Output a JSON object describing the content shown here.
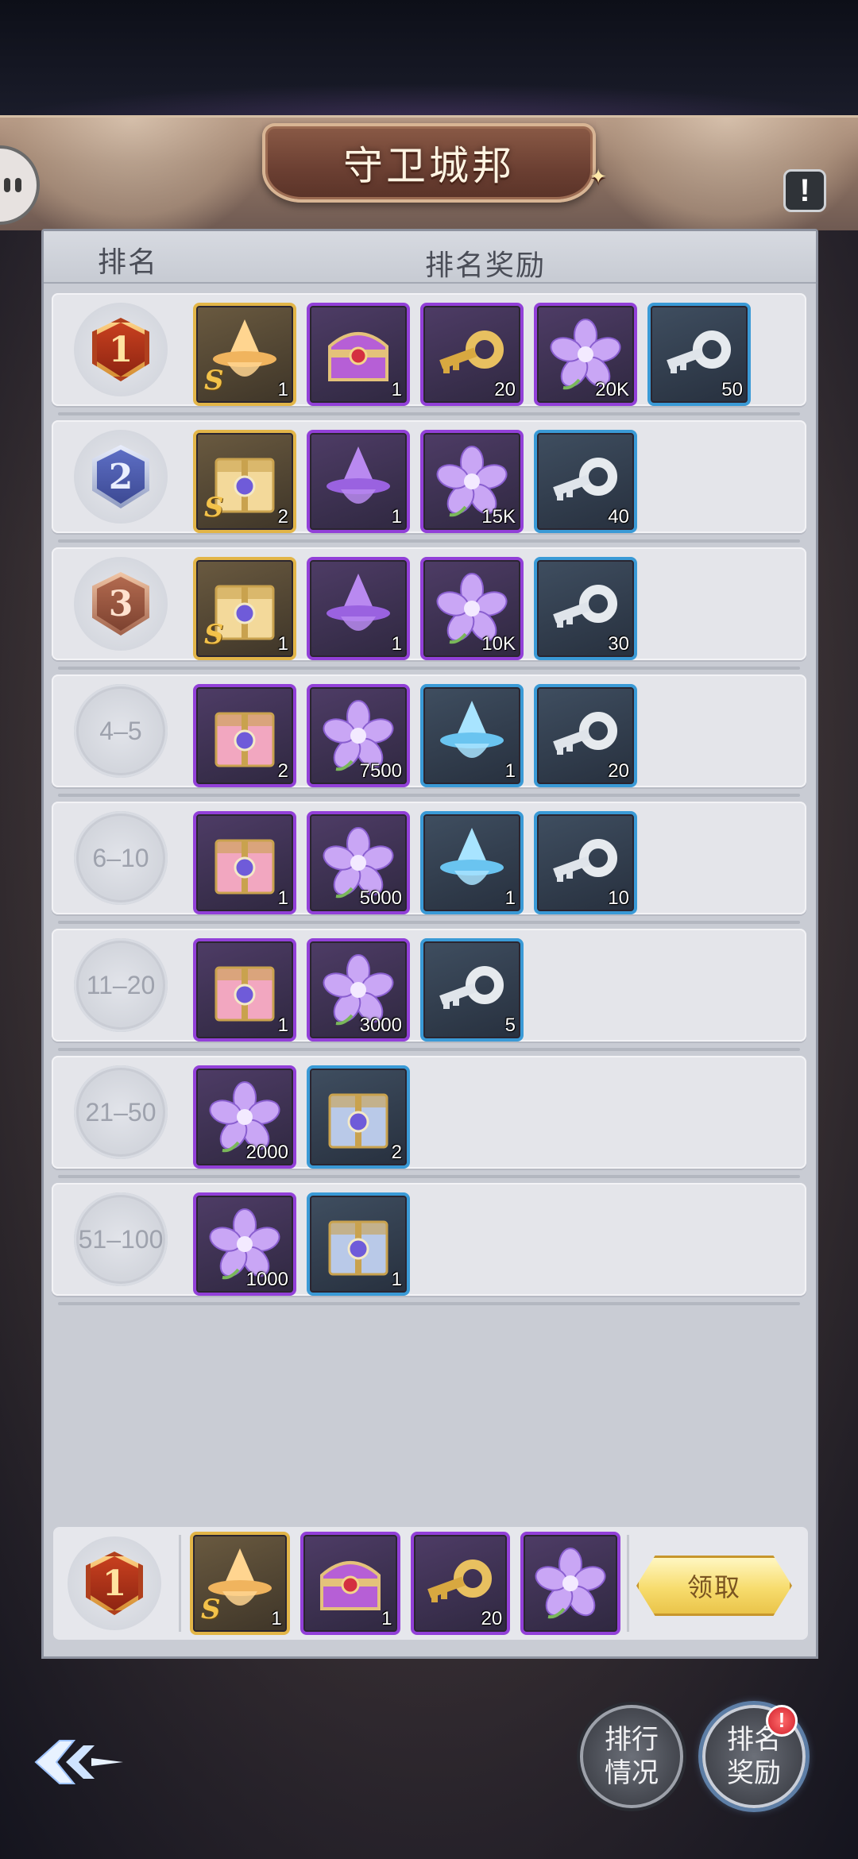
{
  "header": {
    "title": "守卫城邦"
  },
  "table": {
    "col_rank": "排名",
    "col_reward": "排名奖励"
  },
  "rows": [
    {
      "rank": "1",
      "medal": "gold",
      "items": [
        {
          "type": "hat",
          "tier": "gold",
          "qty": "1",
          "s": true
        },
        {
          "type": "chest",
          "tier": "purple",
          "qty": "1"
        },
        {
          "type": "key-gold",
          "tier": "purple",
          "qty": "20"
        },
        {
          "type": "flower",
          "tier": "purple",
          "qty": "20K"
        },
        {
          "type": "key-silver",
          "tier": "blue",
          "qty": "50"
        }
      ]
    },
    {
      "rank": "2",
      "medal": "silver",
      "items": [
        {
          "type": "box-gold",
          "tier": "gold",
          "qty": "2",
          "s": true
        },
        {
          "type": "hat-purple",
          "tier": "purple",
          "qty": "1"
        },
        {
          "type": "flower",
          "tier": "purple",
          "qty": "15K"
        },
        {
          "type": "key-silver",
          "tier": "blue",
          "qty": "40"
        }
      ]
    },
    {
      "rank": "3",
      "medal": "bronze",
      "items": [
        {
          "type": "box-gold",
          "tier": "gold",
          "qty": "1",
          "s": true
        },
        {
          "type": "hat-purple",
          "tier": "purple",
          "qty": "1"
        },
        {
          "type": "flower",
          "tier": "purple",
          "qty": "10K"
        },
        {
          "type": "key-silver",
          "tier": "blue",
          "qty": "30"
        }
      ]
    },
    {
      "rank": "4–5",
      "medal": "plain",
      "items": [
        {
          "type": "box-pink",
          "tier": "purple",
          "qty": "2"
        },
        {
          "type": "flower",
          "tier": "purple",
          "qty": "7500"
        },
        {
          "type": "hat-blue",
          "tier": "blue",
          "qty": "1"
        },
        {
          "type": "key-silver",
          "tier": "blue",
          "qty": "20"
        }
      ]
    },
    {
      "rank": "6–10",
      "medal": "plain",
      "items": [
        {
          "type": "box-pink",
          "tier": "purple",
          "qty": "1"
        },
        {
          "type": "flower",
          "tier": "purple",
          "qty": "5000"
        },
        {
          "type": "hat-blue",
          "tier": "blue",
          "qty": "1"
        },
        {
          "type": "key-silver",
          "tier": "blue",
          "qty": "10"
        }
      ]
    },
    {
      "rank": "11–20",
      "medal": "plain",
      "items": [
        {
          "type": "box-pink",
          "tier": "purple",
          "qty": "1"
        },
        {
          "type": "flower",
          "tier": "purple",
          "qty": "3000"
        },
        {
          "type": "key-silver",
          "tier": "blue",
          "qty": "5"
        }
      ]
    },
    {
      "rank": "21–50",
      "medal": "plain",
      "items": [
        {
          "type": "flower",
          "tier": "purple",
          "qty": "2000"
        },
        {
          "type": "box-blue",
          "tier": "blue",
          "qty": "2"
        }
      ]
    },
    {
      "rank": "51–100",
      "medal": "plain",
      "items": [
        {
          "type": "flower",
          "tier": "purple",
          "qty": "1000"
        },
        {
          "type": "box-blue",
          "tier": "blue",
          "qty": "1"
        }
      ]
    }
  ],
  "my_rank": {
    "rank": "1",
    "items": [
      {
        "type": "hat",
        "tier": "gold",
        "qty": "1",
        "s": true
      },
      {
        "type": "chest",
        "tier": "purple",
        "qty": "1"
      },
      {
        "type": "key-gold",
        "tier": "purple",
        "qty": "20"
      },
      {
        "type": "flower",
        "tier": "purple",
        "qty": ""
      }
    ],
    "claim_label": "领取"
  },
  "nav": {
    "ranking_status": "排行\n情况",
    "ranking_reward": "排名\n奖励",
    "alert_mark": "!"
  },
  "colors": {
    "gold": "#e2b548",
    "purple": "#9240d8",
    "blue": "#3a9ad6"
  }
}
